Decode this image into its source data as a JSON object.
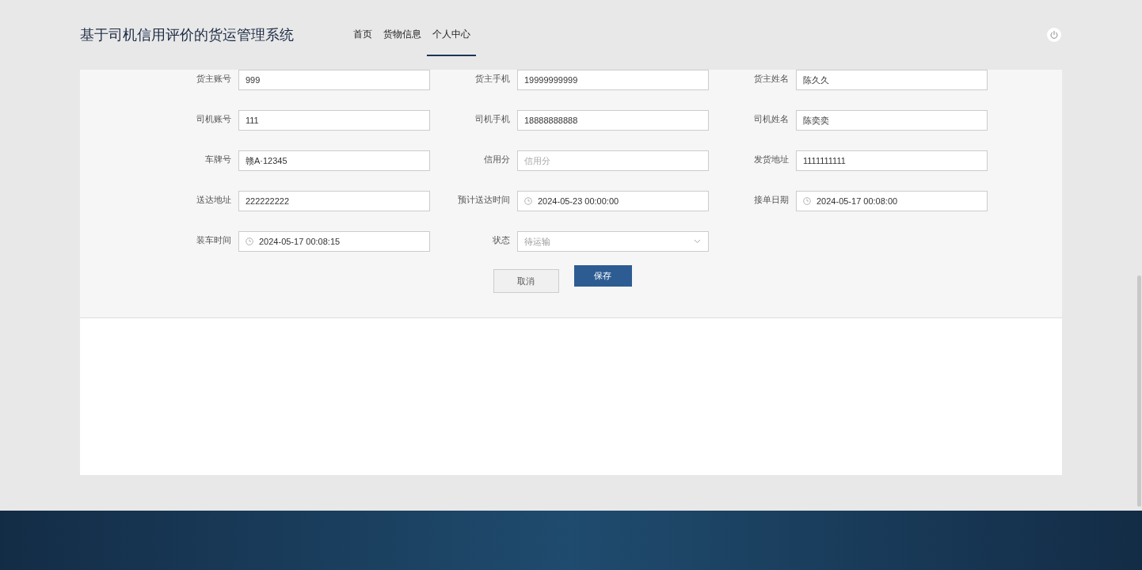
{
  "header": {
    "title": "基于司机信用评价的货运管理系统",
    "nav": [
      {
        "label": "首页",
        "selected": false
      },
      {
        "label": "货物信息",
        "selected": false
      },
      {
        "label": "个人中心",
        "selected": true
      }
    ]
  },
  "form": {
    "fields": [
      {
        "label": "货主账号",
        "kind": "text",
        "value": "999"
      },
      {
        "label": "货主手机",
        "kind": "text",
        "value": "19999999999"
      },
      {
        "label": "货主姓名",
        "kind": "text",
        "value": "陈久久"
      },
      {
        "label": "司机账号",
        "kind": "text",
        "value": "111"
      },
      {
        "label": "司机手机",
        "kind": "text",
        "value": "18888888888"
      },
      {
        "label": "司机姓名",
        "kind": "text",
        "value": "陈奕奕"
      },
      {
        "label": "车牌号",
        "kind": "text",
        "value": "赣A·12345"
      },
      {
        "label": "信用分",
        "kind": "text",
        "placeholder": "信用分"
      },
      {
        "label": "发货地址",
        "kind": "text",
        "value": "1111111111"
      },
      {
        "label": "送达地址",
        "kind": "text",
        "value": "222222222"
      },
      {
        "label": "预计送达时间",
        "kind": "date",
        "value": "2024-05-23 00:00:00"
      },
      {
        "label": "接单日期",
        "kind": "date",
        "value": "2024-05-17 00:08:00"
      },
      {
        "label": "装车时间",
        "kind": "date",
        "value": "2024-05-17 00:08:15"
      },
      {
        "label": "状态",
        "kind": "select",
        "value": "待运输",
        "disabled": true
      }
    ],
    "buttons": [
      {
        "label": "取消",
        "kind": "secondary"
      },
      {
        "label": "保存",
        "kind": "primary"
      }
    ]
  }
}
